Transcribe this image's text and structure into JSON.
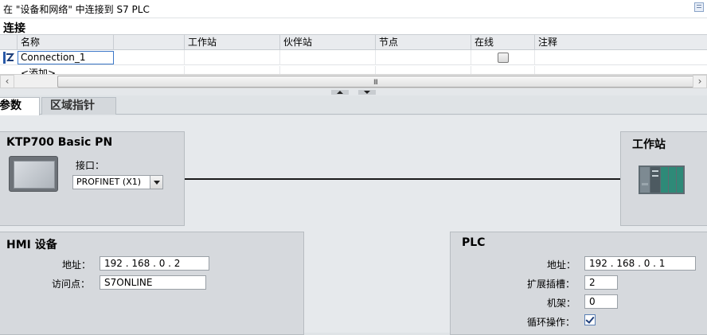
{
  "titlebar": {
    "title": "在 \"设备和网络\" 中连接到 S7 PLC"
  },
  "connections": {
    "section_title": "连接",
    "columns": [
      "名称",
      "工作站",
      "伙伴站",
      "节点",
      "在线",
      "注释"
    ],
    "rows": [
      {
        "name": "Connection_1",
        "online_checked": false
      },
      {
        "name": "<添加>"
      }
    ]
  },
  "scrollbar": {
    "left": "‹",
    "right": "›",
    "grip": "III"
  },
  "tabs": [
    {
      "label": "参数",
      "active": true
    },
    {
      "label": "区域指针",
      "active": false
    }
  ],
  "hmi_station": {
    "title": "KTP700 Basic PN",
    "interface_label": "接口：",
    "interface_value": "PROFINET (X1)"
  },
  "workstation": {
    "title": "工作站"
  },
  "hmi_device": {
    "title": "HMI 设备",
    "address_label": "地址：",
    "address_value": "192  .  168  .  0     .  2",
    "access_point_label": "访问点：",
    "access_point_value": "S7ONLINE"
  },
  "plc": {
    "title": "PLC",
    "address_label": "地址：",
    "address_value": "192  .  168  .  0     .  1",
    "slot_label": "扩展插槽：",
    "slot_value": "2",
    "rack_label": "机架：",
    "rack_value": "0",
    "cyclic_label": "循环操作：",
    "cyclic_checked": true
  },
  "icons": {
    "pin": "pin-icon",
    "connection": "connection-icon",
    "hmi": "hmi-panel-icon",
    "workstation": "plc-rack-icon"
  },
  "colors": {
    "selection_border": "#3c78c8",
    "panel_bg": "#d6d9dd",
    "link": "#1a1a1a"
  }
}
